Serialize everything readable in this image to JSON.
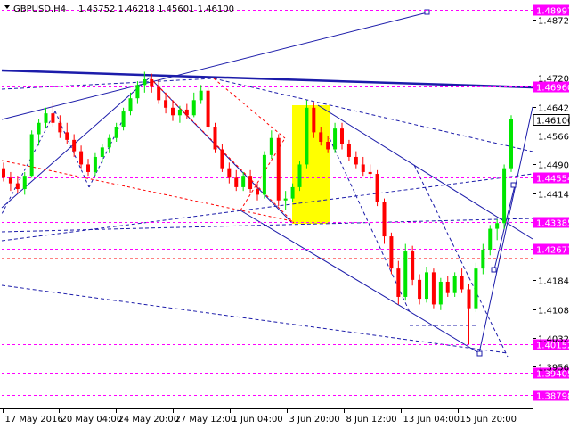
{
  "header": {
    "symbol_label": "GBPUSD,H4",
    "ohlc_label": "1.45752 1.46218 1.45601 1.46100"
  },
  "colors": {
    "bull": "#00e600",
    "bear": "#ff0000",
    "price_line": "#ff00ff",
    "trend": "#1c1caa",
    "highlight": "#ffff00",
    "current_price_box": "#ffffff"
  },
  "chart_data": {
    "type": "candlestick",
    "symbol": "GBPUSD",
    "timeframe": "H4",
    "ohlc": {
      "open": 1.45752,
      "high": 1.46218,
      "low": 1.45601,
      "close": 1.461
    },
    "y_range": [
      1.385,
      1.492
    ],
    "y_ticks": [
      1.4872,
      1.472,
      1.4642,
      1.4566,
      1.449,
      1.4414,
      1.4184,
      1.4108,
      1.4032,
      1.3956
    ],
    "x_ticks": [
      "17 May 2016",
      "20 May 04:00",
      "24 May 20:00",
      "27 May 12:00",
      "1 Jun 04:00",
      "3 Jun 20:00",
      "8 Jun 12:00",
      "13 Jun 04:00",
      "15 Jun 20:00"
    ],
    "price_levels": [
      {
        "value": 1.48997,
        "label": "1.48997"
      },
      {
        "value": 1.4696,
        "label": "1.46960"
      },
      {
        "value": 1.44554,
        "label": "1.44554"
      },
      {
        "value": 1.43385,
        "label": "1.43385"
      },
      {
        "value": 1.42677,
        "label": "1.42677"
      },
      {
        "value": 1.40152,
        "label": "1.40152"
      },
      {
        "value": 1.39405,
        "label": "1.39405"
      },
      {
        "value": 1.38798,
        "label": "1.38798"
      }
    ],
    "current_price": {
      "value": 1.461,
      "label": "1.46100"
    },
    "grid": false,
    "candles": [
      [
        1.448,
        1.4495,
        1.4445,
        1.4455
      ],
      [
        1.4455,
        1.447,
        1.442,
        1.444
      ],
      [
        1.444,
        1.446,
        1.4415,
        1.4425
      ],
      [
        1.4425,
        1.447,
        1.441,
        1.446
      ],
      [
        1.446,
        1.458,
        1.4455,
        1.457
      ],
      [
        1.457,
        1.461,
        1.454,
        1.46
      ],
      [
        1.46,
        1.464,
        1.4585,
        1.4625
      ],
      [
        1.4625,
        1.4655,
        1.459,
        1.46
      ],
      [
        1.46,
        1.462,
        1.456,
        1.4575
      ],
      [
        1.4575,
        1.46,
        1.4545,
        1.4555
      ],
      [
        1.4555,
        1.457,
        1.451,
        1.4525
      ],
      [
        1.4525,
        1.454,
        1.448,
        1.449
      ],
      [
        1.449,
        1.4505,
        1.446,
        1.447
      ],
      [
        1.447,
        1.452,
        1.446,
        1.451
      ],
      [
        1.451,
        1.4545,
        1.4495,
        1.4535
      ],
      [
        1.4535,
        1.457,
        1.452,
        1.456
      ],
      [
        1.456,
        1.46,
        1.455,
        1.459
      ],
      [
        1.459,
        1.464,
        1.458,
        1.463
      ],
      [
        1.463,
        1.468,
        1.462,
        1.4665
      ],
      [
        1.4665,
        1.471,
        1.465,
        1.47
      ],
      [
        1.47,
        1.4735,
        1.468,
        1.4715
      ],
      [
        1.4715,
        1.473,
        1.468,
        1.4695
      ],
      [
        1.4695,
        1.4715,
        1.465,
        1.466
      ],
      [
        1.466,
        1.468,
        1.4625,
        1.464
      ],
      [
        1.464,
        1.466,
        1.4605,
        1.462
      ],
      [
        1.462,
        1.4645,
        1.46,
        1.4635
      ],
      [
        1.4635,
        1.465,
        1.461,
        1.462
      ],
      [
        1.462,
        1.468,
        1.4615,
        1.466
      ],
      [
        1.466,
        1.47,
        1.465,
        1.4685
      ],
      [
        1.4685,
        1.4695,
        1.458,
        1.459
      ],
      [
        1.459,
        1.46,
        1.452,
        1.453
      ],
      [
        1.453,
        1.4545,
        1.447,
        1.448
      ],
      [
        1.448,
        1.4495,
        1.444,
        1.4455
      ],
      [
        1.4455,
        1.4475,
        1.442,
        1.443
      ],
      [
        1.443,
        1.447,
        1.442,
        1.446
      ],
      [
        1.446,
        1.4475,
        1.4415,
        1.4425
      ],
      [
        1.4425,
        1.444,
        1.4395,
        1.441
      ],
      [
        1.441,
        1.4525,
        1.44,
        1.4515
      ],
      [
        1.4515,
        1.458,
        1.4505,
        1.456
      ],
      [
        1.456,
        1.457,
        1.438,
        1.4395
      ],
      [
        1.4395,
        1.442,
        1.437,
        1.44
      ],
      [
        1.44,
        1.444,
        1.439,
        1.443
      ],
      [
        1.443,
        1.45,
        1.442,
        1.449
      ],
      [
        1.449,
        1.466,
        1.448,
        1.464
      ],
      [
        1.464,
        1.4655,
        1.456,
        1.4575
      ],
      [
        1.4575,
        1.459,
        1.454,
        1.455
      ],
      [
        1.455,
        1.4565,
        1.452,
        1.453
      ],
      [
        1.453,
        1.46,
        1.452,
        1.4585
      ],
      [
        1.4585,
        1.46,
        1.453,
        1.4545
      ],
      [
        1.4545,
        1.4555,
        1.45,
        1.451
      ],
      [
        1.451,
        1.4525,
        1.448,
        1.449
      ],
      [
        1.449,
        1.451,
        1.446,
        1.447
      ],
      [
        1.447,
        1.449,
        1.445,
        1.4465
      ],
      [
        1.4465,
        1.4475,
        1.438,
        1.439
      ],
      [
        1.439,
        1.44,
        1.428,
        1.43
      ],
      [
        1.43,
        1.431,
        1.42,
        1.4215
      ],
      [
        1.4215,
        1.4235,
        1.412,
        1.414
      ],
      [
        1.414,
        1.428,
        1.413,
        1.426
      ],
      [
        1.426,
        1.4275,
        1.417,
        1.4185
      ],
      [
        1.4185,
        1.42,
        1.412,
        1.4135
      ],
      [
        1.4135,
        1.422,
        1.4125,
        1.4205
      ],
      [
        1.4205,
        1.4215,
        1.411,
        1.412
      ],
      [
        1.412,
        1.419,
        1.4105,
        1.418
      ],
      [
        1.418,
        1.4195,
        1.414,
        1.415
      ],
      [
        1.415,
        1.4205,
        1.414,
        1.4195
      ],
      [
        1.4195,
        1.4215,
        1.415,
        1.416
      ],
      [
        1.416,
        1.4175,
        1.4015,
        1.411
      ],
      [
        1.411,
        1.423,
        1.41,
        1.4215
      ],
      [
        1.4215,
        1.428,
        1.42,
        1.4265
      ],
      [
        1.4265,
        1.433,
        1.425,
        1.432
      ],
      [
        1.432,
        1.4345,
        1.429,
        1.4335
      ],
      [
        1.4335,
        1.449,
        1.432,
        1.448
      ],
      [
        1.448,
        1.462,
        1.447,
        1.461
      ]
    ]
  }
}
